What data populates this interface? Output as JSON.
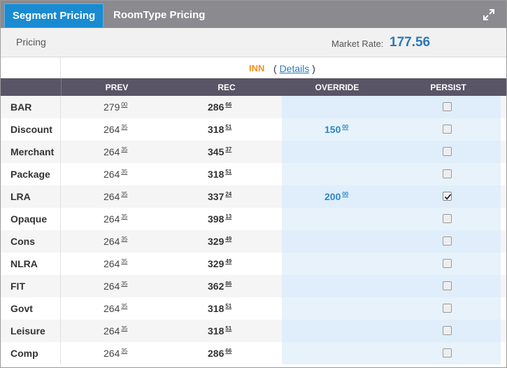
{
  "tabs": {
    "segment_label": "Segment Pricing",
    "roomtype_label": "RoomType Pricing"
  },
  "pricing_bar": {
    "label": "Pricing",
    "market_rate_label": "Market Rate:",
    "market_rate_value": "177.56"
  },
  "property": {
    "name": "INN",
    "details_open": "(",
    "details_label": "Details",
    "details_close": ")"
  },
  "columns": {
    "prev": "PREV",
    "rec": "REC",
    "override": "OVERRIDE",
    "persist": "PERSIST"
  },
  "rows": [
    {
      "name": "BAR",
      "prev": "279",
      "prev_cents": "00",
      "rec": "286",
      "rec_cents": "66",
      "override": "",
      "override_cents": "",
      "persist": false
    },
    {
      "name": "Discount",
      "prev": "264",
      "prev_cents": "35",
      "rec": "318",
      "rec_cents": "51",
      "override": "150",
      "override_cents": "00",
      "persist": false
    },
    {
      "name": "Merchant",
      "prev": "264",
      "prev_cents": "35",
      "rec": "345",
      "rec_cents": "37",
      "override": "",
      "override_cents": "",
      "persist": false
    },
    {
      "name": "Package",
      "prev": "264",
      "prev_cents": "35",
      "rec": "318",
      "rec_cents": "51",
      "override": "",
      "override_cents": "",
      "persist": false
    },
    {
      "name": "LRA",
      "prev": "264",
      "prev_cents": "35",
      "rec": "337",
      "rec_cents": "24",
      "override": "200",
      "override_cents": "00",
      "persist": true
    },
    {
      "name": "Opaque",
      "prev": "264",
      "prev_cents": "35",
      "rec": "398",
      "rec_cents": "13",
      "override": "",
      "override_cents": "",
      "persist": false
    },
    {
      "name": "Cons",
      "prev": "264",
      "prev_cents": "35",
      "rec": "329",
      "rec_cents": "49",
      "override": "",
      "override_cents": "",
      "persist": false
    },
    {
      "name": "NLRA",
      "prev": "264",
      "prev_cents": "35",
      "rec": "329",
      "rec_cents": "49",
      "override": "",
      "override_cents": "",
      "persist": false
    },
    {
      "name": "FIT",
      "prev": "264",
      "prev_cents": "35",
      "rec": "362",
      "rec_cents": "86",
      "override": "",
      "override_cents": "",
      "persist": false
    },
    {
      "name": "Govt",
      "prev": "264",
      "prev_cents": "35",
      "rec": "318",
      "rec_cents": "51",
      "override": "",
      "override_cents": "",
      "persist": false
    },
    {
      "name": "Leisure",
      "prev": "264",
      "prev_cents": "35",
      "rec": "318",
      "rec_cents": "51",
      "override": "",
      "override_cents": "",
      "persist": false
    },
    {
      "name": "Comp",
      "prev": "264",
      "prev_cents": "35",
      "rec": "286",
      "rec_cents": "66",
      "override": "",
      "override_cents": "",
      "persist": false
    }
  ],
  "colors": {
    "active_tab": "#1a8bd0",
    "tab_bar": "#8a8a8f",
    "header": "#595566",
    "market_rate": "#2b79b6",
    "property_name": "#f0901e",
    "override_value": "#2b86c5",
    "override_column": "#dfeefa"
  },
  "icons": {
    "expand": "expand-icon",
    "checkbox_checked": "checkmark-icon"
  }
}
